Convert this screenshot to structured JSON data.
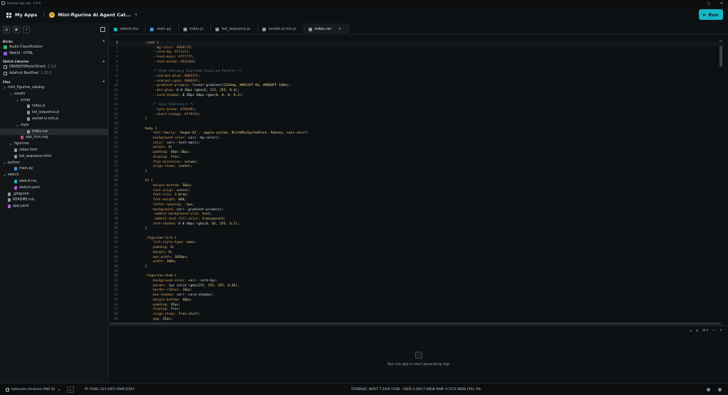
{
  "window": {
    "title": "Arduino App Lab - 0.0.0"
  },
  "header": {
    "my_apps": "My Apps",
    "app_name": "Mini-figurine AI Agent Cat...",
    "run_label": "Run"
  },
  "sidebar": {
    "bricks_title": "Bricks",
    "bricks": [
      {
        "label": "Audio Classification",
        "color": "#3fb36b"
      },
      {
        "label": "WebUI - HTML",
        "color": "#8e5fd6"
      }
    ],
    "libraries_title": "Sketch Libraries",
    "libraries": [
      {
        "label": "DRV8835MotorShield",
        "version": "2.1.0"
      },
      {
        "label": "Adafruit NeoPixel",
        "version": "1.15.5"
      }
    ],
    "files_title": "Files",
    "files": [
      {
        "label": "mini_figurine_catalog",
        "depth": 0,
        "twisty": "▾",
        "kind": "folder"
      },
      {
        "label": "assets",
        "depth": 1,
        "twisty": "▾",
        "kind": "folder"
      },
      {
        "label": "script",
        "depth": 2,
        "twisty": "▾",
        "kind": "folder"
      },
      {
        "label": "index.js",
        "depth": 3,
        "twisty": "",
        "kind": "file"
      },
      {
        "label": "led_sequence.js",
        "depth": 3,
        "twisty": "",
        "kind": "file"
      },
      {
        "label": "socket.io.min.js",
        "depth": 3,
        "twisty": "",
        "kind": "file"
      },
      {
        "label": "style",
        "depth": 2,
        "twisty": "▾",
        "kind": "folder"
      },
      {
        "label": "index.css",
        "depth": 3,
        "twisty": "",
        "kind": "file",
        "selected": true
      },
      {
        "label": "app_icon.svg",
        "depth": 2,
        "twisty": "",
        "kind": "image"
      },
      {
        "label": "figurines",
        "depth": 1,
        "twisty": "▸",
        "kind": "folder"
      },
      {
        "label": "index.html",
        "depth": 1,
        "twisty": "",
        "kind": "file"
      },
      {
        "label": "led_sequence.html",
        "depth": 1,
        "twisty": "",
        "kind": "file"
      },
      {
        "label": "python",
        "depth": 0,
        "twisty": "▾",
        "kind": "folder"
      },
      {
        "label": "main.py",
        "depth": 1,
        "twisty": "",
        "kind": "python"
      },
      {
        "label": "sketch",
        "depth": 0,
        "twisty": "▾",
        "kind": "folder"
      },
      {
        "label": "sketch.ino",
        "depth": 1,
        "twisty": "",
        "kind": "ino"
      },
      {
        "label": "sketch.yaml",
        "depth": 1,
        "twisty": "",
        "kind": "yaml"
      },
      {
        "label": ".gitignore",
        "depth": 0,
        "twisty": "",
        "kind": "file"
      },
      {
        "label": "README.md",
        "depth": 0,
        "twisty": "",
        "kind": "file"
      },
      {
        "label": "app.yaml",
        "depth": 0,
        "twisty": "",
        "kind": "yaml"
      }
    ]
  },
  "tabs": [
    {
      "label": "sketch.ino",
      "icon": "ino"
    },
    {
      "label": "main.py",
      "icon": "python"
    },
    {
      "label": "index.js",
      "icon": "file"
    },
    {
      "label": "led_sequence.js",
      "icon": "file"
    },
    {
      "label": "socket.io.min.js",
      "icon": "file"
    },
    {
      "label": "index.css",
      "icon": "file",
      "active": true
    }
  ],
  "code_lines": [
    [
      [
        ":root {",
        "k"
      ]
    ],
    [
      [
        "    --bg-color: ",
        "p"
      ],
      [
        "#0b0f19",
        "h"
      ],
      [
        ";",
        "pl"
      ]
    ],
    [
      [
        "    --card-bg: ",
        "p"
      ],
      [
        "#151a2c",
        "h"
      ],
      [
        ";",
        "pl"
      ]
    ],
    [
      [
        "    --text-main: ",
        "p"
      ],
      [
        "#ffffff",
        "h"
      ],
      [
        ";",
        "pl"
      ]
    ],
    [
      [
        "    --text-muted: ",
        "p"
      ],
      [
        "#94a3b8",
        "h"
      ],
      [
        ";",
        "pl"
      ]
    ],
    [
      [
        "",
        "pl"
      ]
    ],
    [
      [
        "    /* High-Vibrancy Qualcomm-Inspired Palette */",
        "c"
      ]
    ],
    [
      [
        "    --vibrant-blue: ",
        "p"
      ],
      [
        "#0052FF",
        "h"
      ],
      [
        ";",
        "pl"
      ]
    ],
    [
      [
        "    --vibrant-cyan: ",
        "p"
      ],
      [
        "#00D4FF",
        "h"
      ],
      [
        ";",
        "pl"
      ]
    ],
    [
      [
        "    --gradient-primary: ",
        "p"
      ],
      [
        "linear-gradient(",
        "v"
      ],
      [
        "135deg",
        "n"
      ],
      [
        ", ",
        "pl"
      ],
      [
        "#0052FF 0%",
        "n"
      ],
      [
        ", ",
        "pl"
      ],
      [
        "#00D4FF 100%",
        "n"
      ],
      [
        ");",
        "pl"
      ]
    ],
    [
      [
        "    --btn-glow: ",
        "p"
      ],
      [
        "0 0 20px rgba(",
        "v"
      ],
      [
        "0, 212, 255, 0.4",
        "n"
      ],
      [
        ");",
        "pl"
      ]
    ],
    [
      [
        "    --card-shadow: ",
        "p"
      ],
      [
        "0 20px 40px rgba(",
        "v"
      ],
      [
        "0, 0, 0, 0.3",
        "n"
      ],
      [
        ");",
        "pl"
      ]
    ],
    [
      [
        "",
        "pl"
      ]
    ],
    [
      [
        "    /* Sync Indicators */",
        "c"
      ]
    ],
    [
      [
        "    --sync-green: ",
        "p"
      ],
      [
        "#10b981",
        "h"
      ],
      [
        ";",
        "pl"
      ]
    ],
    [
      [
        "    --alert-orange: ",
        "p"
      ],
      [
        "#ff9f43",
        "h"
      ],
      [
        ";",
        "pl"
      ]
    ],
    [
      [
        "}",
        "pl"
      ]
    ],
    [
      [
        "",
        "pl"
      ]
    ],
    [
      [
        "body {",
        "k"
      ]
    ],
    [
      [
        "    font-family: ",
        "p"
      ],
      [
        "'Segoe UI', -apple-system, BlinkMacSystemFont, Roboto, sans-serif",
        "n"
      ],
      [
        ";",
        "pl"
      ]
    ],
    [
      [
        "    background-color: ",
        "p"
      ],
      [
        "var(--bg-color)",
        "v"
      ],
      [
        ";",
        "pl"
      ]
    ],
    [
      [
        "    color: ",
        "p"
      ],
      [
        "var(--text-main)",
        "v"
      ],
      [
        ";",
        "pl"
      ]
    ],
    [
      [
        "    margin: ",
        "p"
      ],
      [
        "0",
        "n"
      ],
      [
        ";",
        "pl"
      ]
    ],
    [
      [
        "    padding: ",
        "p"
      ],
      [
        "40px 20px",
        "n"
      ],
      [
        ";",
        "pl"
      ]
    ],
    [
      [
        "    display: ",
        "p"
      ],
      [
        "flex",
        "n"
      ],
      [
        ";",
        "pl"
      ]
    ],
    [
      [
        "    flex-direction: ",
        "p"
      ],
      [
        "column",
        "n"
      ],
      [
        ";",
        "pl"
      ]
    ],
    [
      [
        "    align-items: ",
        "p"
      ],
      [
        "center",
        "n"
      ],
      [
        ";",
        "pl"
      ]
    ],
    [
      [
        "}",
        "pl"
      ]
    ],
    [
      [
        "",
        "pl"
      ]
    ],
    [
      [
        "h1 {",
        "k"
      ]
    ],
    [
      [
        "    margin-bottom: ",
        "p"
      ],
      [
        "50px",
        "n"
      ],
      [
        ";",
        "pl"
      ]
    ],
    [
      [
        "    text-align: ",
        "p"
      ],
      [
        "center",
        "n"
      ],
      [
        ";",
        "pl"
      ]
    ],
    [
      [
        "    font-size: ",
        "p"
      ],
      [
        "2.8rem",
        "n"
      ],
      [
        ";",
        "pl"
      ]
    ],
    [
      [
        "    font-weight: ",
        "p"
      ],
      [
        "800",
        "n"
      ],
      [
        ";",
        "pl"
      ]
    ],
    [
      [
        "    letter-spacing: ",
        "p"
      ],
      [
        "-1px",
        "n"
      ],
      [
        ";",
        "pl"
      ]
    ],
    [
      [
        "    background: ",
        "p"
      ],
      [
        "var(--gradient-primary)",
        "v"
      ],
      [
        ";",
        "pl"
      ]
    ],
    [
      [
        "    -webkit-background-clip: ",
        "p"
      ],
      [
        "text",
        "n"
      ],
      [
        ";",
        "pl"
      ]
    ],
    [
      [
        "    -webkit-text-fill-color: ",
        "p"
      ],
      [
        "transparent",
        "n"
      ],
      [
        ";",
        "pl"
      ]
    ],
    [
      [
        "    text-shadow: ",
        "p"
      ],
      [
        "0 0 40px rgba(",
        "v"
      ],
      [
        "0, 82, 255, 0.2",
        "n"
      ],
      [
        ");",
        "pl"
      ]
    ],
    [
      [
        "}",
        "pl"
      ]
    ],
    [
      [
        "",
        "pl"
      ]
    ],
    [
      [
        ".figurine-list {",
        "k"
      ]
    ],
    [
      [
        "    list-style-type: ",
        "p"
      ],
      [
        "none",
        "n"
      ],
      [
        ";",
        "pl"
      ]
    ],
    [
      [
        "    padding: ",
        "p"
      ],
      [
        "0",
        "n"
      ],
      [
        ";",
        "pl"
      ]
    ],
    [
      [
        "    margin: ",
        "p"
      ],
      [
        "0",
        "n"
      ],
      [
        ";",
        "pl"
      ]
    ],
    [
      [
        "    max-width: ",
        "p"
      ],
      [
        "1050px",
        "n"
      ],
      [
        ";",
        "pl"
      ]
    ],
    [
      [
        "    width: ",
        "p"
      ],
      [
        "100%",
        "n"
      ],
      [
        ";",
        "pl"
      ]
    ],
    [
      [
        "}",
        "pl"
      ]
    ],
    [
      [
        "",
        "pl"
      ]
    ],
    [
      [
        ".figurine-item {",
        "k"
      ]
    ],
    [
      [
        "    background-color: ",
        "p"
      ],
      [
        "var(--card-bg)",
        "v"
      ],
      [
        ";",
        "pl"
      ]
    ],
    [
      [
        "    border: ",
        "p"
      ],
      [
        "1px solid rgba(",
        "v"
      ],
      [
        "255, 255, 255, 0.05",
        "n"
      ],
      [
        ");",
        "pl"
      ]
    ],
    [
      [
        "    border-radius: ",
        "p"
      ],
      [
        "16px",
        "n"
      ],
      [
        ";",
        "pl"
      ]
    ],
    [
      [
        "    box-shadow: ",
        "p"
      ],
      [
        "var(--card-shadow)",
        "v"
      ],
      [
        ";",
        "pl"
      ]
    ],
    [
      [
        "    margin-bottom: ",
        "p"
      ],
      [
        "40px",
        "n"
      ],
      [
        ";",
        "pl"
      ]
    ],
    [
      [
        "    padding: ",
        "p"
      ],
      [
        "35px",
        "n"
      ],
      [
        ";",
        "pl"
      ]
    ],
    [
      [
        "    display: ",
        "p"
      ],
      [
        "flex",
        "n"
      ],
      [
        ";",
        "pl"
      ]
    ],
    [
      [
        "    align-items: ",
        "p"
      ],
      [
        "flex-start",
        "n"
      ],
      [
        ";",
        "pl"
      ]
    ],
    [
      [
        "    gap: ",
        "p"
      ],
      [
        "35px",
        "n"
      ],
      [
        ";",
        "pl"
      ]
    ]
  ],
  "console": {
    "message": "Run the app to start generating logs",
    "tools": [
      "⌖",
      "⏱",
      "⊞ ▾",
      "—",
      "✕"
    ]
  },
  "status": {
    "board": "kotlumen (Arduino UNO Q)",
    "ip": "IP: FE80::321:1857:694F:D3F2",
    "storage": "STORAGE: BOOT 7.53/9.72GB · USER 4.29/17.09GB   RAM: 0.37/3.58GB   CPU: 4%"
  },
  "colors": {
    "accent": "#17b6c4"
  }
}
